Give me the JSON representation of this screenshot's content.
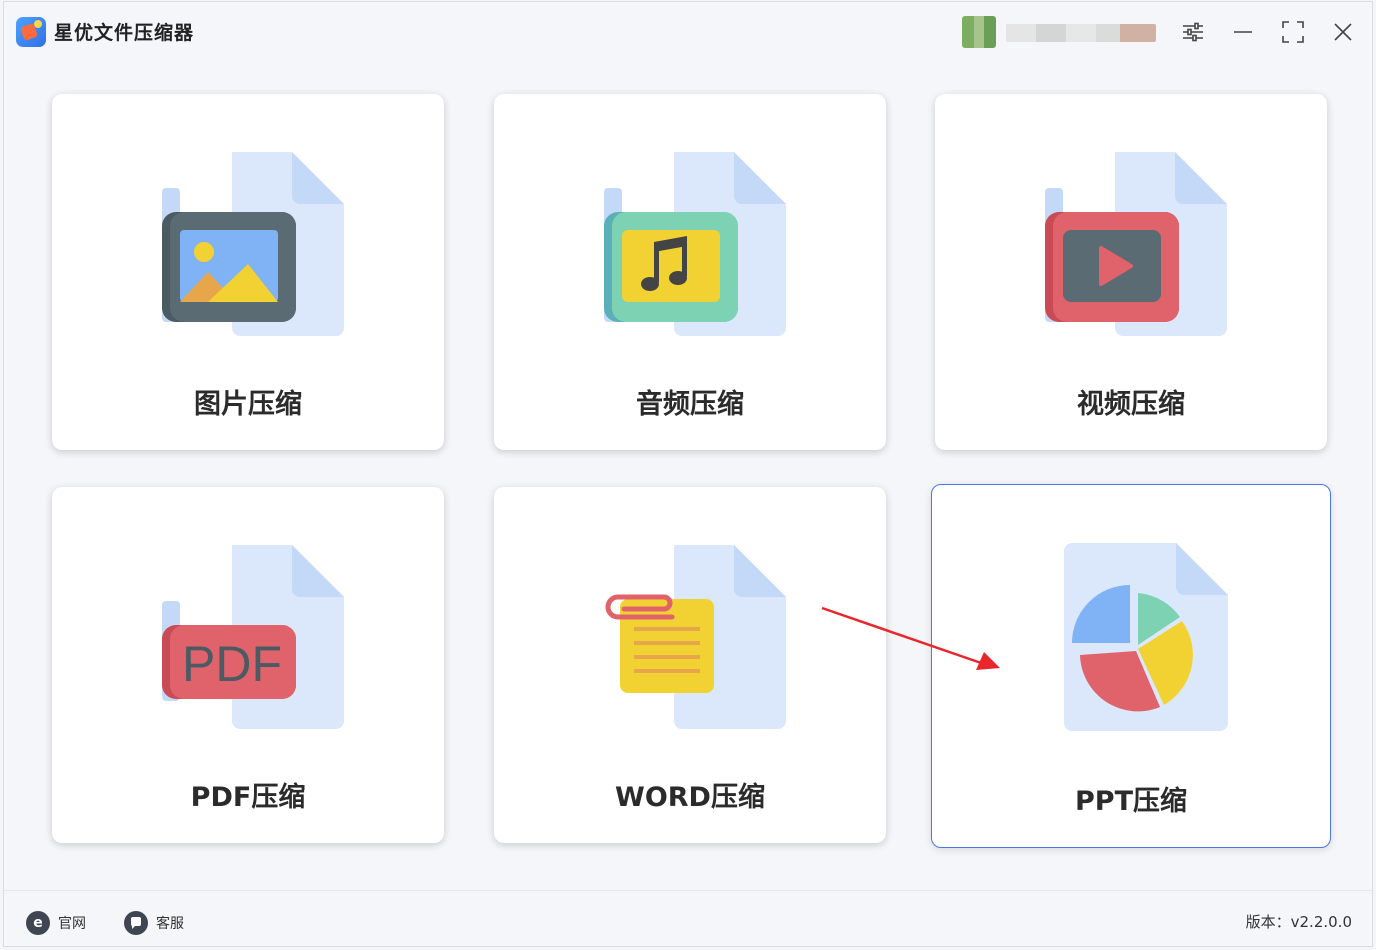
{
  "app": {
    "title": "星优文件压缩器"
  },
  "user": {
    "avatar": "avatar-pixelated",
    "name_blurred": true
  },
  "titlebar": {
    "settings_icon": "sliders-icon",
    "minimize_icon": "minimize-icon",
    "maximize_icon": "maximize-icon",
    "close_icon": "close-icon"
  },
  "cards": [
    {
      "label": "图片压缩",
      "icon": "image-file-icon"
    },
    {
      "label": "音频压缩",
      "icon": "audio-file-icon"
    },
    {
      "label": "视频压缩",
      "icon": "video-file-icon"
    },
    {
      "label": "PDF压缩",
      "icon": "pdf-file-icon"
    },
    {
      "label": "WORD压缩",
      "icon": "word-file-icon"
    },
    {
      "label": "PPT压缩",
      "icon": "ppt-file-icon",
      "selected": true
    }
  ],
  "footer": {
    "website_label": "官网",
    "website_icon_glyph": "e",
    "service_label": "客服",
    "version": "版本：v2.2.0.0"
  },
  "colors": {
    "accent": "#4a78e6",
    "file_bg": "#dbe8fb",
    "file_fold": "#c4d8f8",
    "red": "#e0626a",
    "yellow": "#f2d232",
    "teal": "#7ed2b4",
    "dark": "#5b6b73",
    "blue": "#7fb3f6",
    "arrow": "#e8262b"
  }
}
